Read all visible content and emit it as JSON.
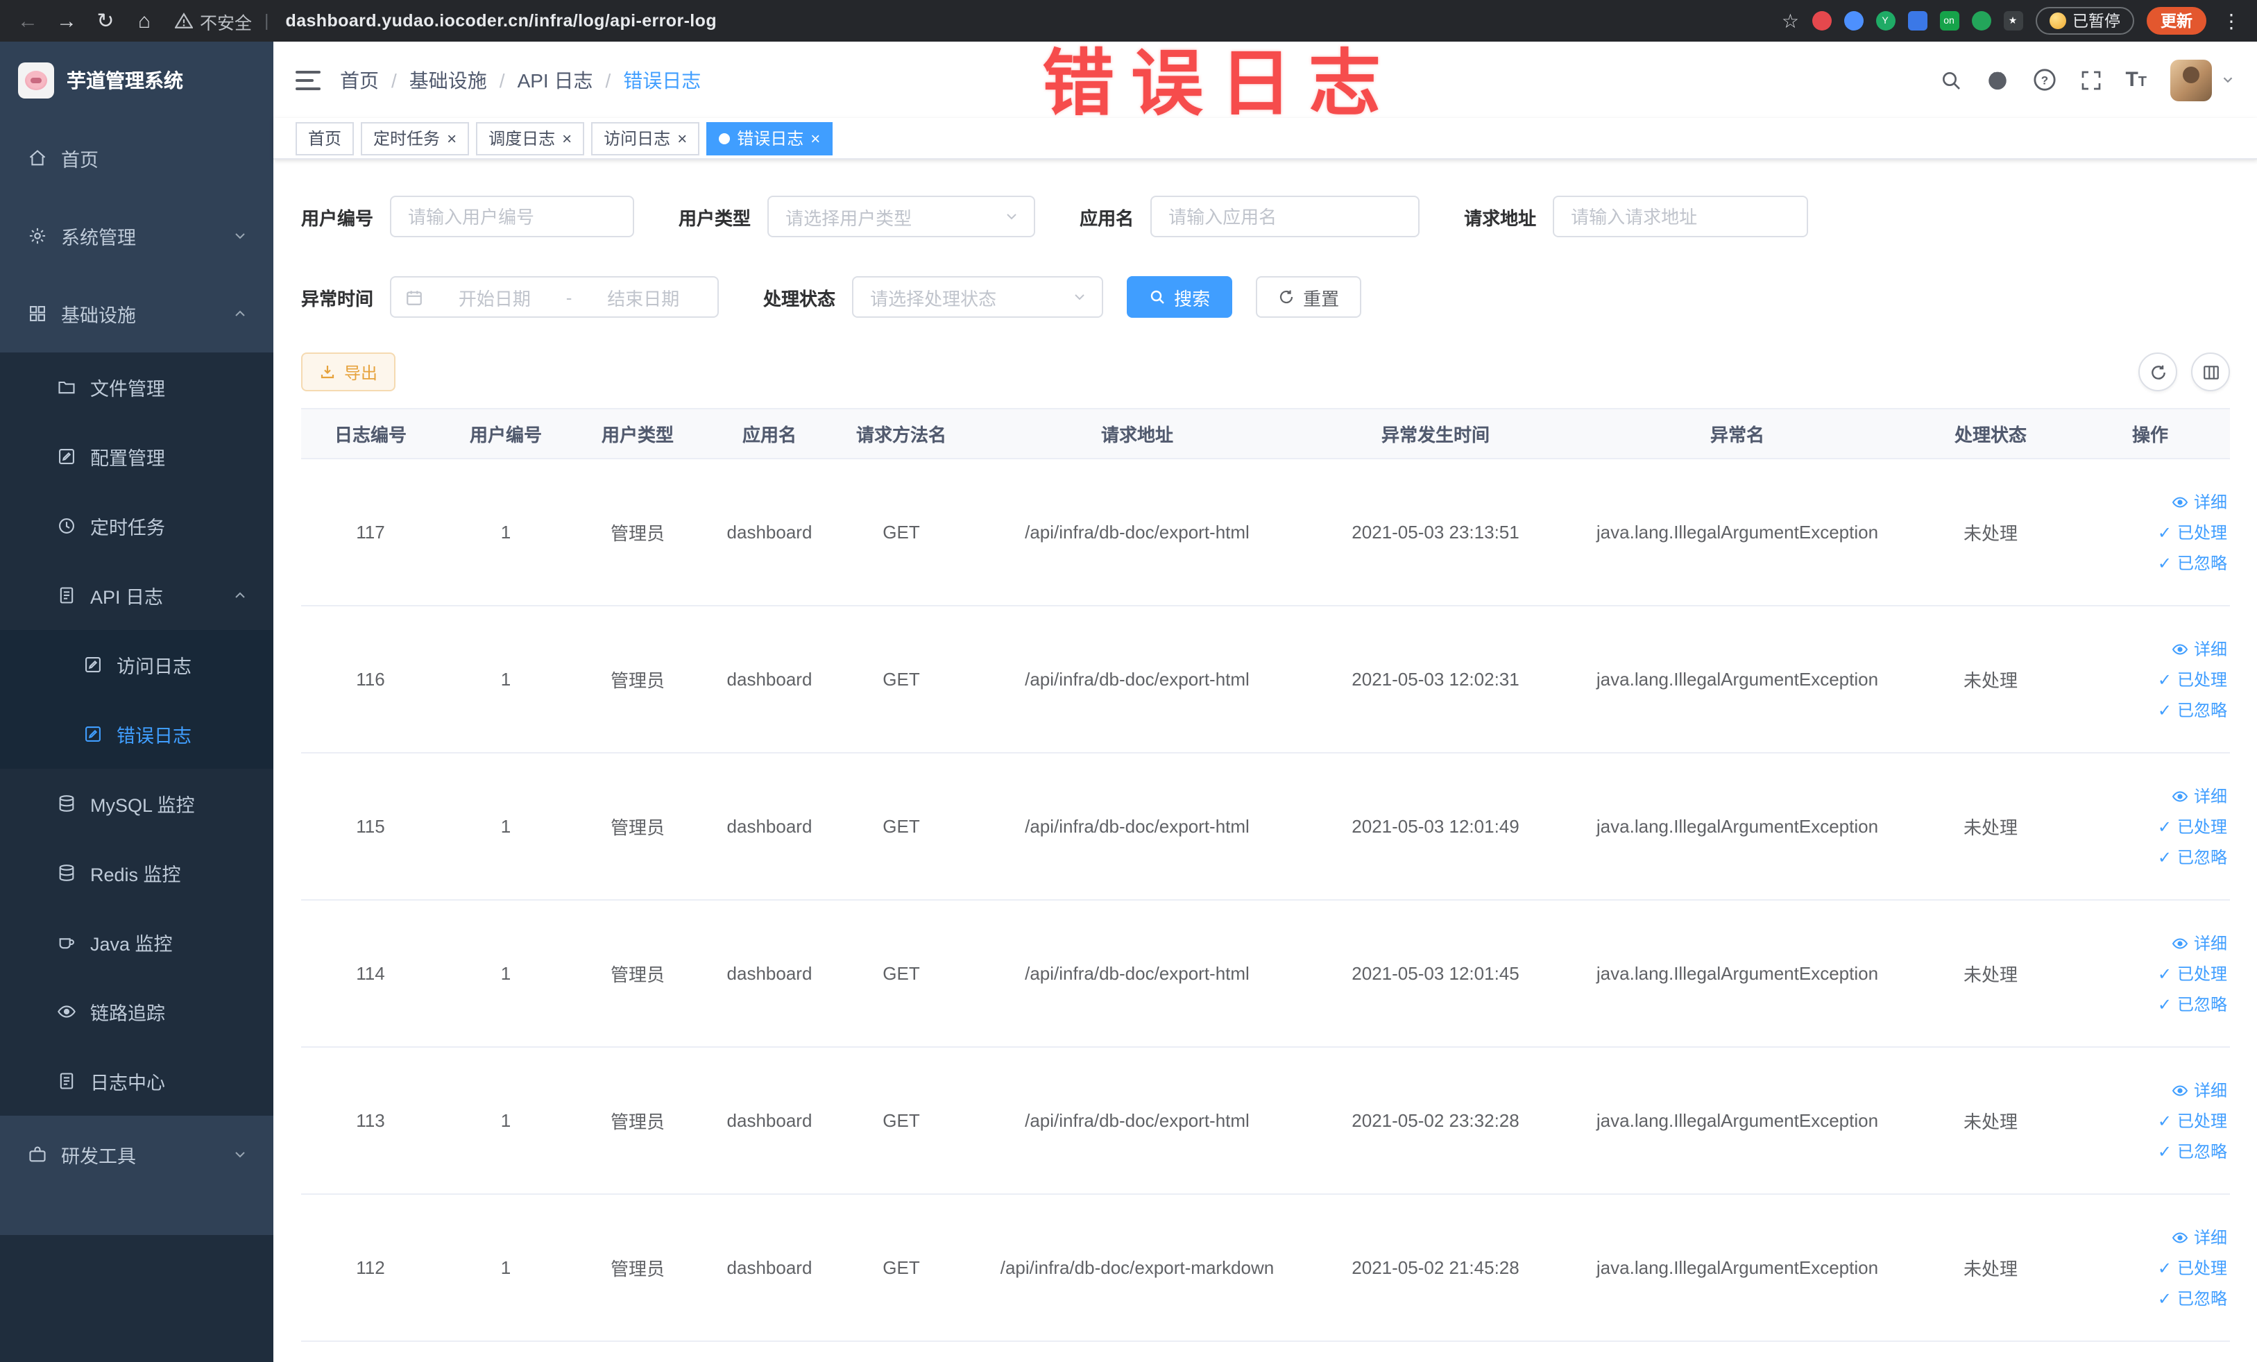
{
  "colors": {
    "accent": "#409eff",
    "warning": "#e6a23c",
    "overlay_red": "#f64c4c",
    "sidebar_bg": "#304156",
    "submenu_bg": "#1f2d3d",
    "chrome_bg": "#25272b",
    "update_button_bg": "#e3572e",
    "active_tab_bg": "#409eff"
  },
  "overlay": {
    "title": "错误日志"
  },
  "browser": {
    "security_label": "不安全",
    "url": "dashboard.yudao.iocoder.cn/infra/log/api-error-log",
    "paused_button": "已暂停",
    "update_button": "更新"
  },
  "sidebar": {
    "logo_title": "芋道管理系统",
    "items": [
      {
        "id": "home",
        "label": "首页",
        "icon": "home",
        "level": "top"
      },
      {
        "id": "system",
        "label": "系统管理",
        "icon": "gear",
        "level": "top",
        "chevron": "down"
      },
      {
        "id": "infra",
        "label": "基础设施",
        "icon": "grid",
        "level": "top",
        "chevron": "up"
      },
      {
        "id": "file",
        "label": "文件管理",
        "icon": "folder",
        "level": "sub1"
      },
      {
        "id": "config",
        "label": "配置管理",
        "icon": "edit",
        "level": "sub1"
      },
      {
        "id": "job",
        "label": "定时任务",
        "icon": "clock",
        "level": "sub1"
      },
      {
        "id": "api-log",
        "label": "API 日志",
        "icon": "doc",
        "level": "sub1",
        "chevron": "up"
      },
      {
        "id": "access-log",
        "label": "访问日志",
        "icon": "edit",
        "level": "sub2"
      },
      {
        "id": "error-log",
        "label": "错误日志",
        "icon": "edit",
        "level": "sub2",
        "active": true
      },
      {
        "id": "mysql",
        "label": "MySQL 监控",
        "icon": "db",
        "level": "sub1"
      },
      {
        "id": "redis",
        "label": "Redis 监控",
        "icon": "db",
        "level": "sub1"
      },
      {
        "id": "java",
        "label": "Java 监控",
        "icon": "coffee",
        "level": "sub1"
      },
      {
        "id": "trace",
        "label": "链路追踪",
        "icon": "eye",
        "level": "sub1"
      },
      {
        "id": "log-center",
        "label": "日志中心",
        "icon": "doc",
        "level": "sub1"
      },
      {
        "id": "dev-tools",
        "label": "研发工具",
        "icon": "tools",
        "level": "top",
        "chevron": "down"
      }
    ]
  },
  "breadcrumb": [
    "首页",
    "基础设施",
    "API 日志",
    "错误日志"
  ],
  "tabs": [
    {
      "id": "home",
      "label": "首页",
      "closable": false,
      "active": false
    },
    {
      "id": "job",
      "label": "定时任务",
      "closable": true,
      "active": false
    },
    {
      "id": "job-log",
      "label": "调度日志",
      "closable": true,
      "active": false
    },
    {
      "id": "access-log",
      "label": "访问日志",
      "closable": true,
      "active": false
    },
    {
      "id": "error-log",
      "label": "错误日志",
      "closable": true,
      "active": true
    }
  ],
  "filters": {
    "user_id": {
      "label": "用户编号",
      "placeholder": "请输入用户编号"
    },
    "user_type": {
      "label": "用户类型",
      "placeholder": "请选择用户类型"
    },
    "app_name": {
      "label": "应用名",
      "placeholder": "请输入应用名"
    },
    "request_url": {
      "label": "请求地址",
      "placeholder": "请输入请求地址"
    },
    "exception_time": {
      "label": "异常时间",
      "start_placeholder": "开始日期",
      "separator": "-",
      "end_placeholder": "结束日期"
    },
    "process_status": {
      "label": "处理状态",
      "placeholder": "请选择处理状态"
    },
    "search_label": "搜索",
    "reset_label": "重置"
  },
  "toolbar": {
    "export_label": "导出"
  },
  "table": {
    "columns": [
      "日志编号",
      "用户编号",
      "用户类型",
      "应用名",
      "请求方法名",
      "请求地址",
      "异常发生时间",
      "异常名",
      "处理状态",
      "操作"
    ],
    "row_actions": [
      {
        "label": "详细",
        "icon": "eye"
      },
      {
        "label": "已处理",
        "icon": "check"
      },
      {
        "label": "已忽略",
        "icon": "check"
      }
    ],
    "rows": [
      {
        "id": "117",
        "user_id": "1",
        "user_type": "管理员",
        "app_name": "dashboard",
        "method": "GET",
        "url": "/api/infra/db-doc/export-html",
        "time": "2021-05-03 23:13:51",
        "exception": "java.lang.IllegalArgumentException",
        "status": "未处理"
      },
      {
        "id": "116",
        "user_id": "1",
        "user_type": "管理员",
        "app_name": "dashboard",
        "method": "GET",
        "url": "/api/infra/db-doc/export-html",
        "time": "2021-05-03 12:02:31",
        "exception": "java.lang.IllegalArgumentException",
        "status": "未处理"
      },
      {
        "id": "115",
        "user_id": "1",
        "user_type": "管理员",
        "app_name": "dashboard",
        "method": "GET",
        "url": "/api/infra/db-doc/export-html",
        "time": "2021-05-03 12:01:49",
        "exception": "java.lang.IllegalArgumentException",
        "status": "未处理"
      },
      {
        "id": "114",
        "user_id": "1",
        "user_type": "管理员",
        "app_name": "dashboard",
        "method": "GET",
        "url": "/api/infra/db-doc/export-html",
        "time": "2021-05-03 12:01:45",
        "exception": "java.lang.IllegalArgumentException",
        "status": "未处理"
      },
      {
        "id": "113",
        "user_id": "1",
        "user_type": "管理员",
        "app_name": "dashboard",
        "method": "GET",
        "url": "/api/infra/db-doc/export-html",
        "time": "2021-05-02 23:32:28",
        "exception": "java.lang.IllegalArgumentException",
        "status": "未处理"
      },
      {
        "id": "112",
        "user_id": "1",
        "user_type": "管理员",
        "app_name": "dashboard",
        "method": "GET",
        "url": "/api/infra/db-doc/export-markdown",
        "time": "2021-05-02 21:45:28",
        "exception": "java.lang.IllegalArgumentException",
        "status": "未处理"
      }
    ]
  }
}
